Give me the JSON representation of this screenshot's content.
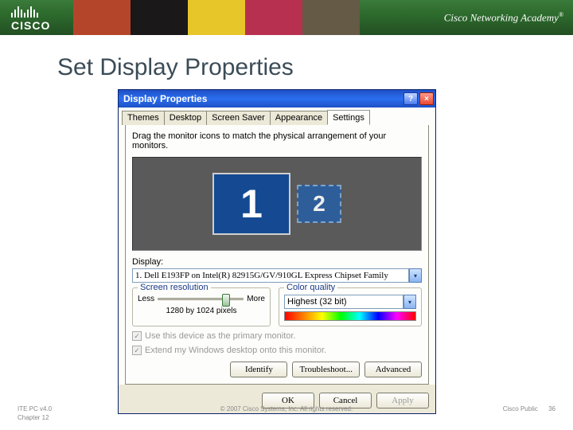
{
  "banner": {
    "brand": "CISCO",
    "academy": "Cisco Networking Academy"
  },
  "slide": {
    "title": "Set Display Properties"
  },
  "dialog": {
    "title": "Display Properties",
    "tabs": {
      "t0": "Themes",
      "t1": "Desktop",
      "t2": "Screen Saver",
      "t3": "Appearance",
      "t4": "Settings"
    },
    "hint": "Drag the monitor icons to match the physical arrangement of your monitors.",
    "mon1": "1",
    "mon2": "2",
    "display_label": "Display:",
    "display_value": "1. Dell E193FP on Intel(R) 82915G/GV/910GL Express Chipset Family",
    "res": {
      "legend": "Screen resolution",
      "less": "Less",
      "more": "More",
      "value": "1280 by 1024 pixels"
    },
    "cq": {
      "legend": "Color quality",
      "value": "Highest (32 bit)"
    },
    "chk1": "Use this device as the primary monitor.",
    "chk2": "Extend my Windows desktop onto this monitor.",
    "btn": {
      "identify": "Identify",
      "troubleshoot": "Troubleshoot...",
      "advanced": "Advanced",
      "ok": "OK",
      "cancel": "Cancel",
      "apply": "Apply"
    }
  },
  "footer": {
    "left1": "ITE PC v4.0",
    "left2": "Chapter 12",
    "mid": "© 2007 Cisco Systems, Inc. All rights reserved.",
    "right1": "Cisco Public",
    "right2": "36"
  }
}
